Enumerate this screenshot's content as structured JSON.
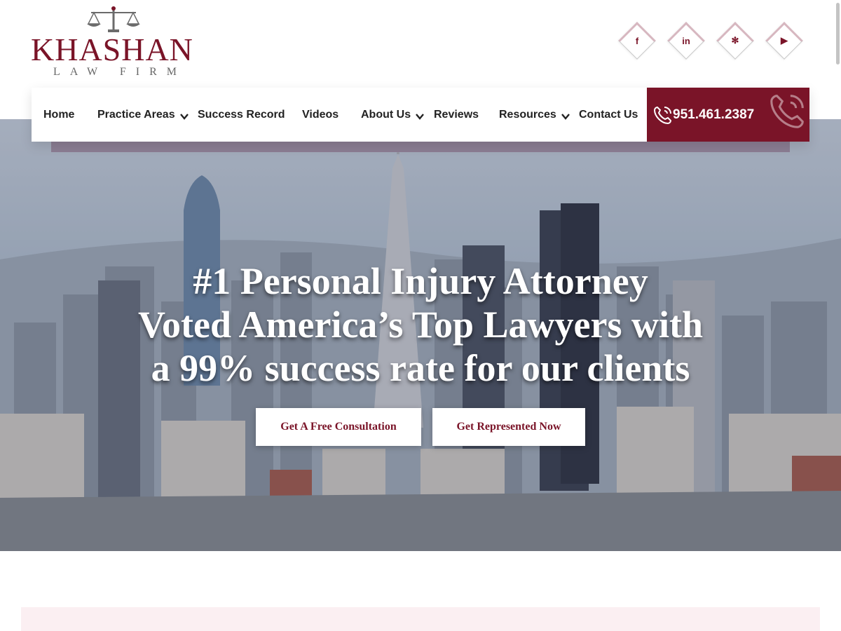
{
  "brand": {
    "name": "KHASHAN",
    "subtitle": "LAW FIRM",
    "color": "#7a1428"
  },
  "social": [
    {
      "name": "facebook-icon",
      "glyph": "f"
    },
    {
      "name": "linkedin-icon",
      "glyph": "in"
    },
    {
      "name": "yelp-icon",
      "glyph": "✻"
    },
    {
      "name": "youtube-icon",
      "glyph": "▶"
    }
  ],
  "nav": {
    "items": [
      {
        "label": "Home",
        "has_dropdown": false
      },
      {
        "label": "Practice Areas",
        "has_dropdown": true
      },
      {
        "label": "Success Record",
        "has_dropdown": false
      },
      {
        "label": "Videos",
        "has_dropdown": false
      },
      {
        "label": "About Us",
        "has_dropdown": true
      },
      {
        "label": "Reviews",
        "has_dropdown": false
      },
      {
        "label": "Resources",
        "has_dropdown": true
      },
      {
        "label": "Contact Us",
        "has_dropdown": false
      }
    ],
    "phone": "951.461.2387"
  },
  "hero": {
    "line1": "#1 Personal Injury Attorney",
    "line2": "Voted America’s Top Lawyers with",
    "line3": "a 99% success rate for our clients",
    "cta_primary": "Get A Free Consultation",
    "cta_secondary": "Get Represented Now"
  }
}
